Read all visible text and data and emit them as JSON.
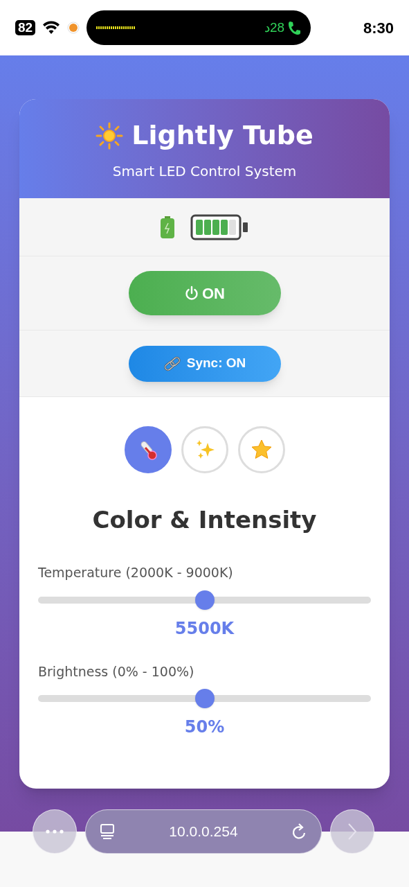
{
  "status_bar": {
    "battery": "82",
    "call_timer": "28د",
    "time": "8:30"
  },
  "header": {
    "title": "Lightly Tube",
    "subtitle": "Smart LED Control System"
  },
  "power_button": {
    "label": "ON",
    "on": true
  },
  "sync_button": {
    "label": "Sync: ON",
    "on": true
  },
  "mode_tabs": [
    {
      "kind": "temperature",
      "selected": true
    },
    {
      "kind": "effects",
      "selected": false
    },
    {
      "kind": "favorites",
      "selected": false
    }
  ],
  "section_title": "Color & Intensity",
  "sliders": [
    {
      "label": "Temperature (2000K - 9000K)",
      "level": 0.5,
      "reading": "5500K"
    },
    {
      "label": "Brightness (0% - 100%)",
      "level": 0.5,
      "reading": "50%"
    }
  ],
  "browser_bar": {
    "url": "10.0.0.254"
  }
}
